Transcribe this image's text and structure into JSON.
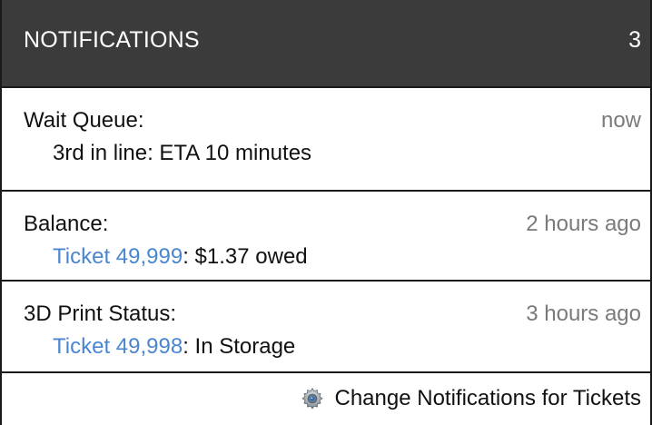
{
  "header": {
    "title": "NOTIFICATIONS",
    "count": "3"
  },
  "notifications": [
    {
      "label": "Wait Queue:",
      "time": "now",
      "detail": "3rd in line: ETA 10 minutes"
    },
    {
      "label": "Balance:",
      "time": "2 hours ago",
      "link_text": "Ticket 49,999",
      "detail_rest": ": $1.37 owed"
    },
    {
      "label": "3D Print Status:",
      "time": "3 hours ago",
      "link_text": "Ticket 49,998",
      "detail_rest": ": In Storage"
    }
  ],
  "footer": {
    "icon": "gear-icon",
    "action_label": "Change Notifications for Tickets"
  },
  "colors": {
    "header_bg": "#3b3b3b",
    "link": "#4a86d0",
    "timestamp": "#7a7a7a",
    "border": "#1a1a1a"
  }
}
